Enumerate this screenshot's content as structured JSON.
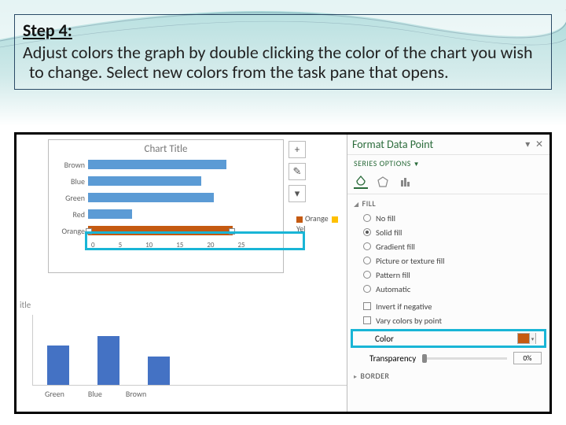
{
  "instruction": {
    "heading": "Step 4:",
    "body": "Adjust colors the graph by double clicking the color of the chart you wish to change. Select new colors from the task pane that opens."
  },
  "chart_data": {
    "type": "bar",
    "orientation": "horizontal",
    "title": "Chart Title",
    "categories": [
      "Brown",
      "Blue",
      "Green",
      "Red",
      "Orange"
    ],
    "values": [
      22,
      18,
      20,
      7,
      23
    ],
    "xlim": [
      0,
      25
    ],
    "xticks": [
      0,
      5,
      10,
      15,
      20,
      25
    ],
    "selected_category": "Orange",
    "legend": [
      "Orange",
      "Yel"
    ],
    "secondary": {
      "type": "bar",
      "orientation": "vertical",
      "title_fragment": "itle",
      "categories": [
        "Green",
        "Blue",
        "Brown"
      ],
      "values": [
        55,
        68,
        40
      ]
    }
  },
  "floating_buttons": {
    "plus": "+",
    "brush": "✎",
    "filter": "▾"
  },
  "pane": {
    "title": "Format Data Point",
    "close_glyph": "▾ ✕",
    "series_label": "SERIES OPTIONS",
    "section_fill": "FILL",
    "options": {
      "no_fill": "No fill",
      "solid_fill": "Solid fill",
      "gradient_fill": "Gradient fill",
      "picture_fill": "Picture or texture fill",
      "pattern_fill": "Pattern fill",
      "automatic": "Automatic",
      "invert_neg": "Invert if negative",
      "vary_colors": "Vary colors by point"
    },
    "color_label": "Color",
    "transparency_label": "Transparency",
    "transparency_value": "0%",
    "section_border": "BORDER"
  }
}
